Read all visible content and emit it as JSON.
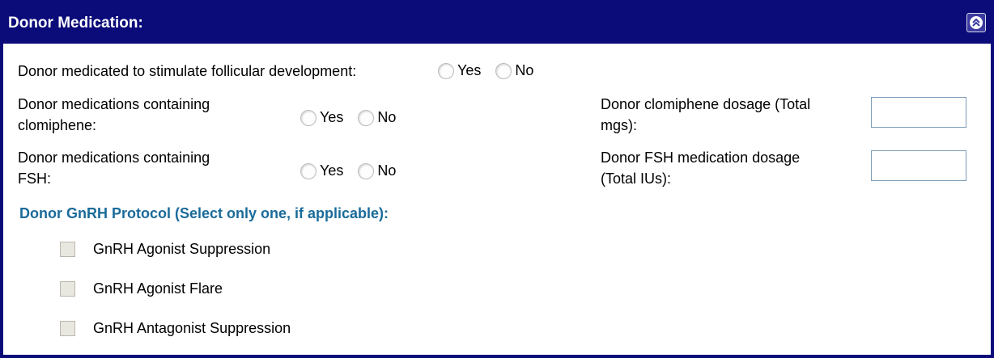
{
  "header": {
    "title": "Donor Medication:",
    "collapse_icon": "double-chevron-up-icon"
  },
  "stimulated": {
    "label": "Donor medicated to stimulate follicular development:",
    "yes": "Yes",
    "no": "No"
  },
  "clomiphene": {
    "label_line1": "Donor medications containing",
    "label_line2": "clomiphene:",
    "yes": "Yes",
    "no": "No",
    "dosage_line1": "Donor clomiphene dosage (Total",
    "dosage_line2": "mgs):",
    "dosage_value": ""
  },
  "fsh": {
    "label_line1": "Donor medications containing",
    "label_line2": "FSH:",
    "yes": "Yes",
    "no": "No",
    "dosage_line1": "Donor FSH medication dosage",
    "dosage_line2": "(Total IUs):",
    "dosage_value": ""
  },
  "gnrh": {
    "title": "Donor GnRH Protocol (Select only one, if applicable):",
    "options": [
      "GnRH Agonist Suppression",
      "GnRH Agonist Flare",
      "GnRH Antagonist Suppression"
    ]
  },
  "colors": {
    "header_bg": "#0b0b7a",
    "section_title": "#1a6b9a"
  }
}
